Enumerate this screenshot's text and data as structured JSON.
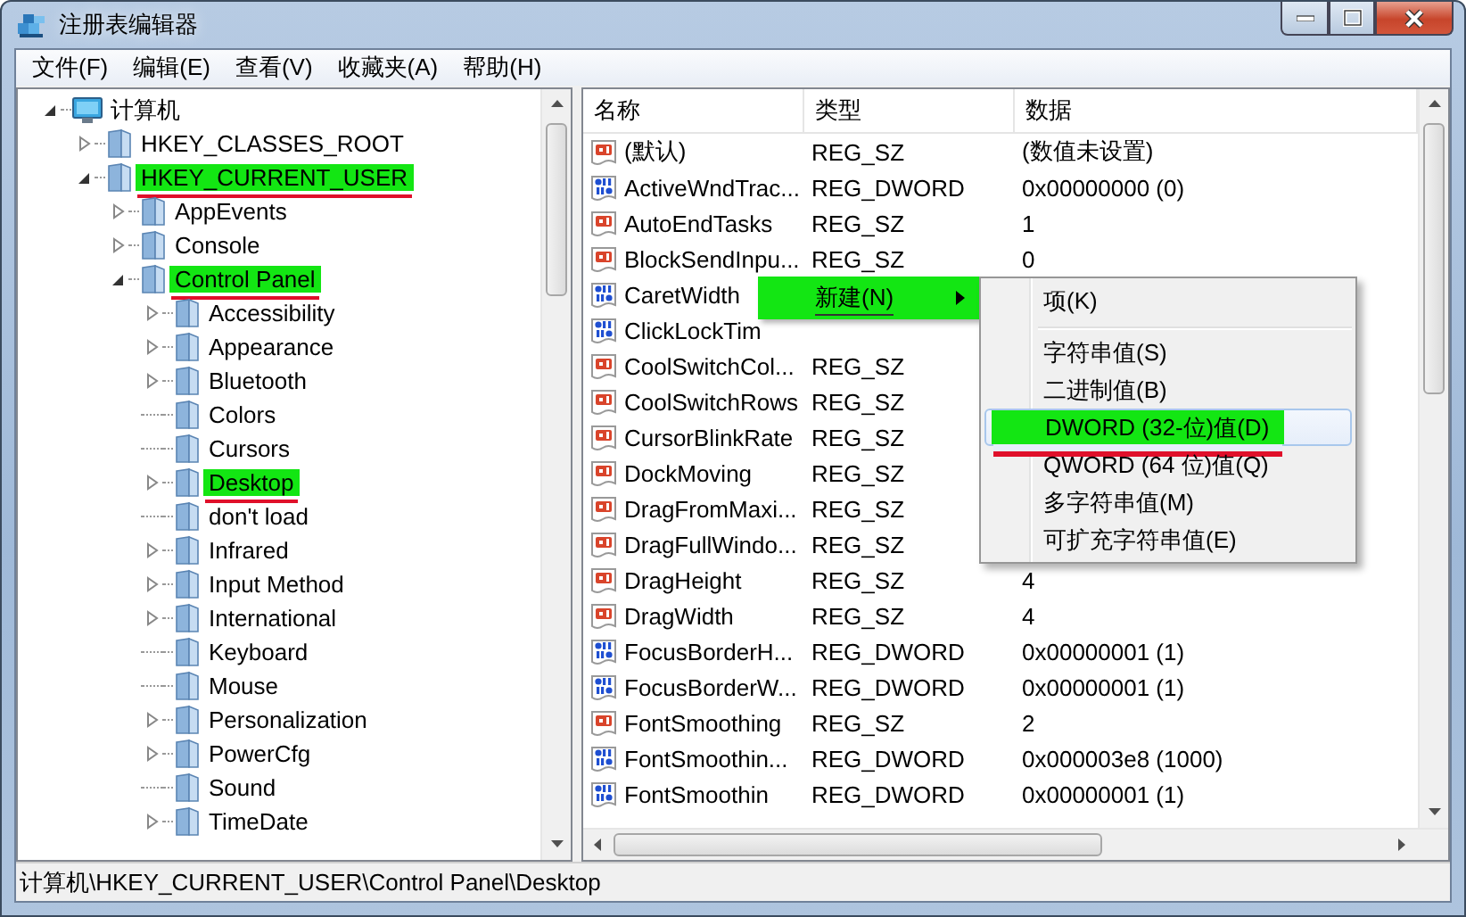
{
  "window": {
    "title": "注册表编辑器"
  },
  "menu_bar": [
    "文件(F)",
    "编辑(E)",
    "查看(V)",
    "收藏夹(A)",
    "帮助(H)"
  ],
  "tree": [
    {
      "label": "计算机",
      "kind": "computer",
      "expanded": true,
      "highlighted": false,
      "children": [
        {
          "label": "HKEY_CLASSES_ROOT",
          "kind": "folder",
          "expanded": false,
          "highlighted": false
        },
        {
          "label": "HKEY_CURRENT_USER",
          "kind": "folder",
          "expanded": true,
          "highlighted": true,
          "children": [
            {
              "label": "AppEvents",
              "kind": "folder",
              "expanded": false,
              "highlighted": false
            },
            {
              "label": "Console",
              "kind": "folder",
              "expanded": false,
              "highlighted": false
            },
            {
              "label": "Control Panel",
              "kind": "folder",
              "expanded": true,
              "highlighted": true,
              "children": [
                {
                  "label": "Accessibility",
                  "kind": "folder",
                  "expanded": false,
                  "highlighted": false
                },
                {
                  "label": "Appearance",
                  "kind": "folder",
                  "expanded": false,
                  "highlighted": false
                },
                {
                  "label": "Bluetooth",
                  "kind": "folder",
                  "expanded": false,
                  "highlighted": false
                },
                {
                  "label": "Colors",
                  "kind": "leaf",
                  "highlighted": false
                },
                {
                  "label": "Cursors",
                  "kind": "leaf",
                  "highlighted": false
                },
                {
                  "label": "Desktop",
                  "kind": "folder",
                  "expanded": false,
                  "highlighted": true
                },
                {
                  "label": "don't load",
                  "kind": "leaf",
                  "highlighted": false
                },
                {
                  "label": "Infrared",
                  "kind": "folder",
                  "expanded": false,
                  "highlighted": false
                },
                {
                  "label": "Input Method",
                  "kind": "folder",
                  "expanded": false,
                  "highlighted": false
                },
                {
                  "label": "International",
                  "kind": "folder",
                  "expanded": false,
                  "highlighted": false
                },
                {
                  "label": "Keyboard",
                  "kind": "leaf",
                  "highlighted": false
                },
                {
                  "label": "Mouse",
                  "kind": "leaf",
                  "highlighted": false
                },
                {
                  "label": "Personalization",
                  "kind": "folder",
                  "expanded": false,
                  "highlighted": false
                },
                {
                  "label": "PowerCfg",
                  "kind": "folder",
                  "expanded": false,
                  "highlighted": false
                },
                {
                  "label": "Sound",
                  "kind": "leaf",
                  "highlighted": false
                },
                {
                  "label": "TimeDate",
                  "kind": "folder",
                  "expanded": false,
                  "highlighted": false
                }
              ]
            }
          ]
        }
      ]
    }
  ],
  "values": {
    "columns": [
      "名称",
      "类型",
      "数据"
    ],
    "rows": [
      {
        "kind": "string",
        "name": "(默认)",
        "type": "REG_SZ",
        "data": "(数值未设置)"
      },
      {
        "kind": "dword",
        "name": "ActiveWndTrac...",
        "type": "REG_DWORD",
        "data": "0x00000000 (0)"
      },
      {
        "kind": "string",
        "name": "AutoEndTasks",
        "type": "REG_SZ",
        "data": "1"
      },
      {
        "kind": "string",
        "name": "BlockSendInpu...",
        "type": "REG_SZ",
        "data": "0"
      },
      {
        "kind": "dword",
        "name": "CaretWidth"
      },
      {
        "kind": "dword",
        "name": "ClickLockTim"
      },
      {
        "kind": "string",
        "name": "CoolSwitchCol...",
        "type": "REG_SZ"
      },
      {
        "kind": "string",
        "name": "CoolSwitchRows",
        "type": "REG_SZ"
      },
      {
        "kind": "string",
        "name": "CursorBlinkRate",
        "type": "REG_SZ"
      },
      {
        "kind": "string",
        "name": "DockMoving",
        "type": "REG_SZ"
      },
      {
        "kind": "string",
        "name": "DragFromMaxi...",
        "type": "REG_SZ"
      },
      {
        "kind": "string",
        "name": "DragFullWindo...",
        "type": "REG_SZ"
      },
      {
        "kind": "string",
        "name": "DragHeight",
        "type": "REG_SZ",
        "data": "4"
      },
      {
        "kind": "string",
        "name": "DragWidth",
        "type": "REG_SZ",
        "data": "4"
      },
      {
        "kind": "dword",
        "name": "FocusBorderH...",
        "type": "REG_DWORD",
        "data": "0x00000001 (1)"
      },
      {
        "kind": "dword",
        "name": "FocusBorderW...",
        "type": "REG_DWORD",
        "data": "0x00000001 (1)"
      },
      {
        "kind": "string",
        "name": "FontSmoothing",
        "type": "REG_SZ",
        "data": "2"
      },
      {
        "kind": "dword",
        "name": "FontSmoothin...",
        "type": "REG_DWORD",
        "data": "0x000003e8 (1000)"
      },
      {
        "kind": "dword",
        "name": "FontSmoothin",
        "type": "REG_DWORD",
        "data": "0x00000001 (1)"
      }
    ]
  },
  "context_menu": {
    "items": [
      {
        "label": "新建(N)",
        "highlighted": true
      }
    ],
    "submenu": [
      {
        "kind": "item",
        "label": "项(K)",
        "highlighted": false
      },
      {
        "kind": "separator"
      },
      {
        "kind": "item",
        "label": "字符串值(S)",
        "highlighted": false
      },
      {
        "kind": "item",
        "label": "二进制值(B)",
        "highlighted": false
      },
      {
        "kind": "item",
        "label": "DWORD (32-位)值(D)",
        "highlighted": true
      },
      {
        "kind": "item",
        "label": "QWORD (64 位)值(Q)",
        "highlighted": false
      },
      {
        "kind": "item",
        "label": "多字符串值(M)",
        "highlighted": false
      },
      {
        "kind": "item",
        "label": "可扩充字符串值(E)",
        "highlighted": false
      }
    ]
  },
  "status_bar": "计算机\\HKEY_CURRENT_USER\\Control Panel\\Desktop"
}
